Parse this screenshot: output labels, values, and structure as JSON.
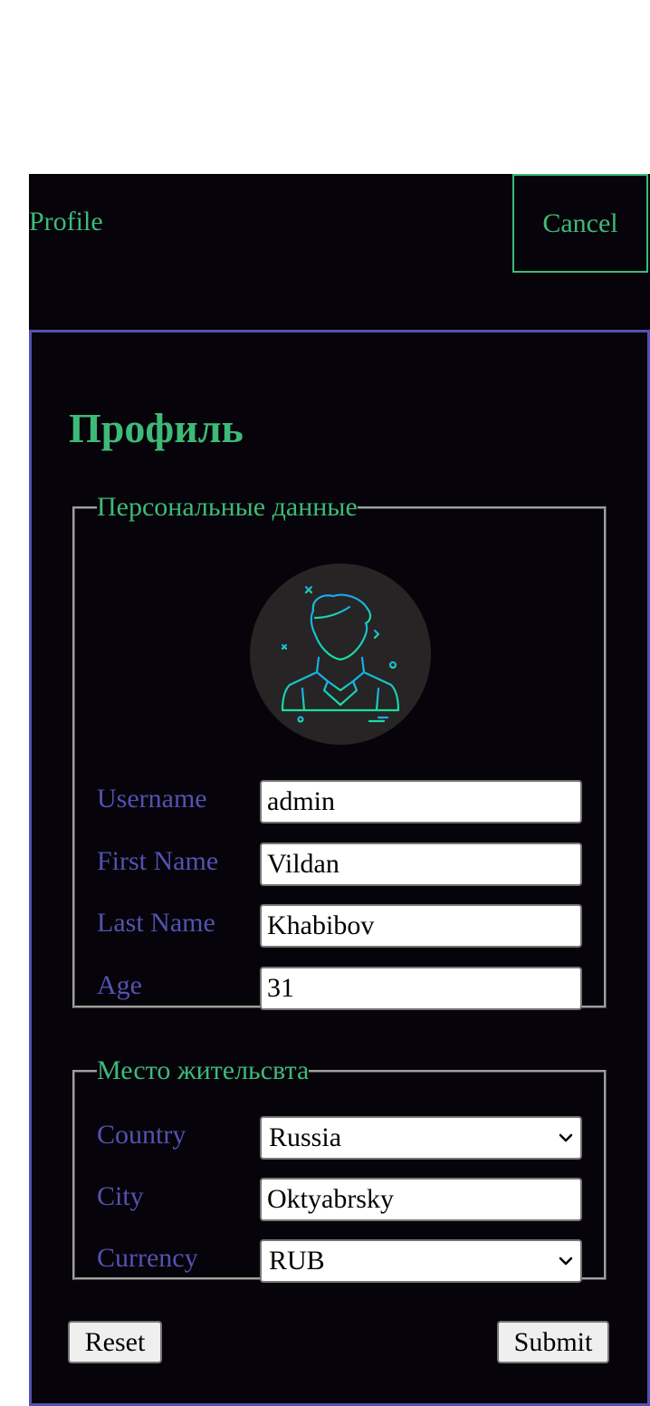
{
  "header": {
    "brand": "Profile",
    "cancel_label": "Cancel"
  },
  "page": {
    "title": "Профиль"
  },
  "personal": {
    "legend": "Персональные данные",
    "avatar_icon": "user-avatar-icon",
    "fields": {
      "username": {
        "label": "Username",
        "value": "admin"
      },
      "first_name": {
        "label": "First Name",
        "value": "Vildan"
      },
      "last_name": {
        "label": "Last Name",
        "value": "Khabibov"
      },
      "age": {
        "label": "Age",
        "value": "31"
      }
    }
  },
  "residence": {
    "legend": "Место жительсвта",
    "fields": {
      "country": {
        "label": "Country",
        "value": "Russia"
      },
      "city": {
        "label": "City",
        "value": "Oktyabrsky"
      },
      "currency": {
        "label": "Currency",
        "value": "RUB"
      }
    }
  },
  "actions": {
    "reset_label": "Reset",
    "submit_label": "Submit"
  },
  "colors": {
    "accent_green": "#3dba78",
    "accent_purple": "#5352b0",
    "background": "#06030a"
  }
}
